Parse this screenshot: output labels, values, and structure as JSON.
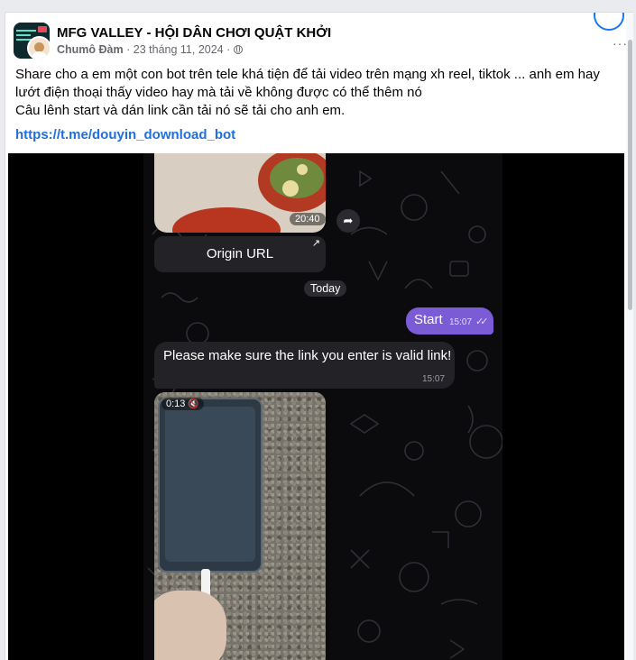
{
  "post": {
    "group_name": "MFG VALLEY - HỘI DÂN CHƠI QUẬT KHỞI",
    "author": "Chumô Đàm",
    "date": "23 tháng 11, 2024",
    "separator": "·",
    "more_label": "···",
    "text_line1": "Share cho a em một con bot trên tele khá tiện để tải video trên mạng xh reel, tiktok ... anh em hay lướt điện thoại thấy video hay mà tải về không được có thể thêm nó",
    "text_line2": "Câu lênh start và dán link cần tải nó sẽ tải cho anh em.",
    "link": "https://t.me/douyin_download_bot"
  },
  "chat": {
    "media_time": "20:40",
    "origin_button": "Origin URL",
    "origin_arrow": "↗",
    "share_icon": "➦",
    "date_divider": "Today",
    "sent_message": "Start",
    "sent_time": "15:07",
    "sent_checks": "✓✓",
    "reply_message": "Please make sure the link you enter is valid link!",
    "reply_time": "15:07",
    "video_duration": "0:13",
    "mute_icon": "🔇"
  }
}
